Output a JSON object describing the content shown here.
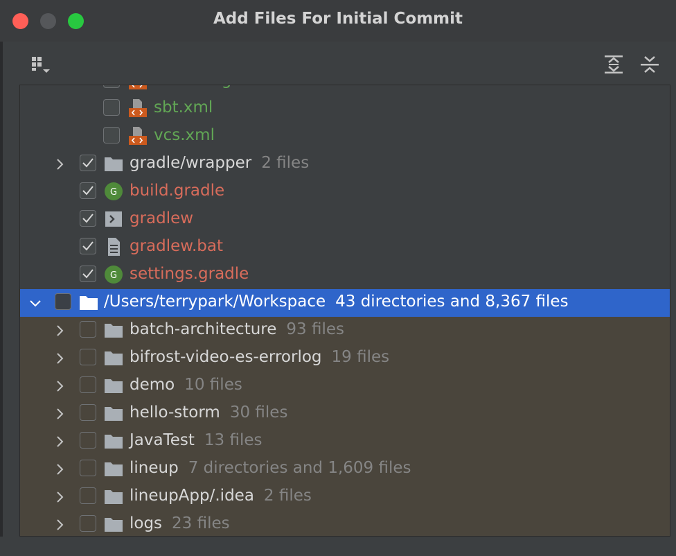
{
  "window": {
    "title": "Add Files For Initial Commit"
  },
  "colors": {
    "added_green": "#62a755",
    "unversioned_red": "#d86c5b",
    "selection_blue": "#2f65ca",
    "band": "#4a453c"
  },
  "toolbar": {
    "group_by_icon": "group-by-icon",
    "expand_all_icon": "expand-all-icon",
    "collapse_all_icon": "collapse-all-icon"
  },
  "tree": {
    "idea_files": [
      {
        "name": "runConfigurations.xml",
        "checked": false,
        "icon": "xml-file-icon"
      },
      {
        "name": "sbt.xml",
        "checked": false,
        "icon": "xml-file-icon"
      },
      {
        "name": "vcs.xml",
        "checked": false,
        "icon": "xml-file-icon"
      }
    ],
    "project_items": [
      {
        "name": "gradle/wrapper",
        "count": "2 files",
        "checked": true,
        "icon": "folder-icon"
      },
      {
        "name": "build.gradle",
        "count": "",
        "checked": true,
        "icon": "gradle-icon"
      },
      {
        "name": "gradlew",
        "count": "",
        "checked": true,
        "icon": "shell-script-icon"
      },
      {
        "name": "gradlew.bat",
        "count": "",
        "checked": true,
        "icon": "text-file-icon"
      },
      {
        "name": "settings.gradle",
        "count": "",
        "checked": true,
        "icon": "gradle-icon"
      }
    ],
    "root": {
      "name": "/Users/terrypark/Workspace",
      "count": "43 directories and 8,367 files",
      "checked": false
    },
    "workspace_items": [
      {
        "name": "batch-architecture",
        "count": "93 files"
      },
      {
        "name": "bifrost-video-es-errorlog",
        "count": "19 files"
      },
      {
        "name": "demo",
        "count": "10 files"
      },
      {
        "name": "hello-storm",
        "count": "30 files"
      },
      {
        "name": "JavaTest",
        "count": "13 files"
      },
      {
        "name": "lineup",
        "count": "7 directories and 1,609 files"
      },
      {
        "name": "lineupApp/.idea",
        "count": "2 files"
      },
      {
        "name": "logs",
        "count": "23 files"
      }
    ]
  }
}
